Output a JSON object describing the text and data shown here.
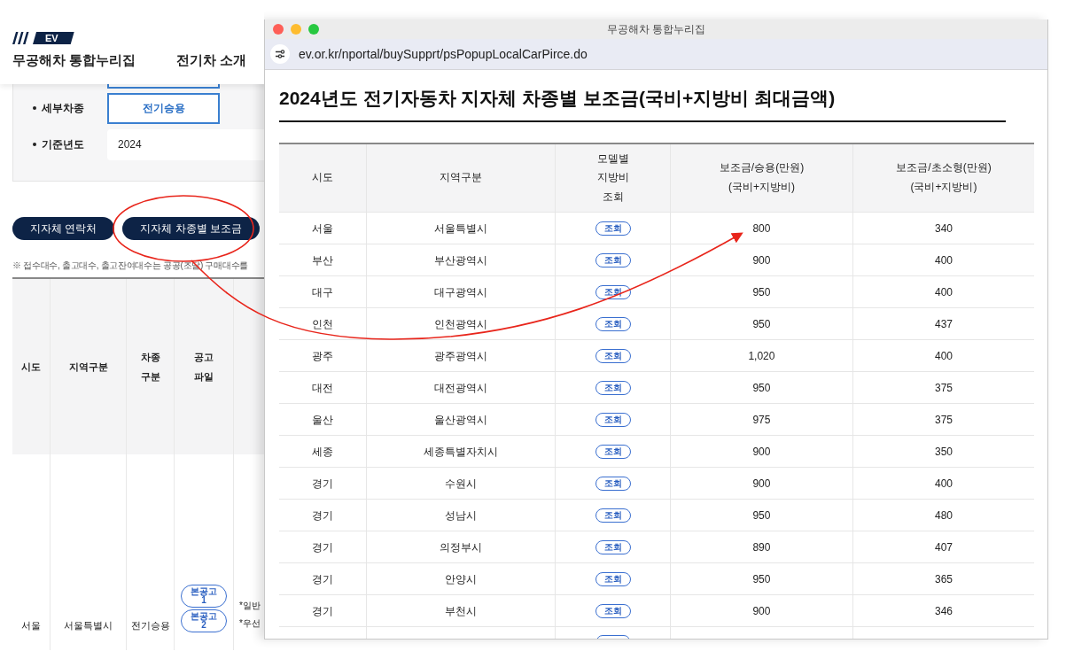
{
  "background_page": {
    "logo_badge": "EV",
    "site_name": "무공해차 통합누리집",
    "nav_item": "전기차 소개",
    "form": [
      {
        "label": "세부차종",
        "kind": "button",
        "value": "전기승용"
      },
      {
        "label": "기준년도",
        "kind": "input",
        "value": "2024"
      }
    ],
    "buttons": [
      "지자체 연락처",
      "지자체 차종별 보조금"
    ],
    "note": "※ 접수대수, 출고대수, 출고잔여대수는 공공(조달) 구매대수를",
    "table": {
      "columns": [
        "시도",
        "지역구분",
        "차종\n구분",
        "공고\n파일"
      ],
      "rows": [
        {
          "cells": [
            "서울",
            "서울특별시",
            "전기승용"
          ],
          "files": [
            "본공고\n1",
            "본공고\n2"
          ],
          "notes": [
            "*일반",
            "*우선"
          ]
        }
      ]
    }
  },
  "popup": {
    "title": "무공해차 통합누리집",
    "url": "ev.or.kr/nportal/buySupprt/psPopupLocalCarPirce.do",
    "heading": "2024년도 전기자동차 지자체 차종별 보조금(국비+지방비 최대금액)",
    "table": {
      "columns": [
        "시도",
        "지역구분",
        "모델별\n지방비\n조회",
        "보조금/승용(만원)\n(국비+지방비)",
        "보조금/초소형(만원)\n(국비+지방비)"
      ],
      "rows": [
        {
          "sido": "서울",
          "region": "서울특별시",
          "lookup": "조회",
          "sedan": "800",
          "compact": "340"
        },
        {
          "sido": "부산",
          "region": "부산광역시",
          "lookup": "조회",
          "sedan": "900",
          "compact": "400"
        },
        {
          "sido": "대구",
          "region": "대구광역시",
          "lookup": "조회",
          "sedan": "950",
          "compact": "400"
        },
        {
          "sido": "인천",
          "region": "인천광역시",
          "lookup": "조회",
          "sedan": "950",
          "compact": "437"
        },
        {
          "sido": "광주",
          "region": "광주광역시",
          "lookup": "조회",
          "sedan": "1,020",
          "compact": "400"
        },
        {
          "sido": "대전",
          "region": "대전광역시",
          "lookup": "조회",
          "sedan": "950",
          "compact": "375"
        },
        {
          "sido": "울산",
          "region": "울산광역시",
          "lookup": "조회",
          "sedan": "975",
          "compact": "375"
        },
        {
          "sido": "세종",
          "region": "세종특별자치시",
          "lookup": "조회",
          "sedan": "900",
          "compact": "350"
        },
        {
          "sido": "경기",
          "region": "수원시",
          "lookup": "조회",
          "sedan": "900",
          "compact": "400"
        },
        {
          "sido": "경기",
          "region": "성남시",
          "lookup": "조회",
          "sedan": "950",
          "compact": "480"
        },
        {
          "sido": "경기",
          "region": "의정부시",
          "lookup": "조회",
          "sedan": "890",
          "compact": "407"
        },
        {
          "sido": "경기",
          "region": "안양시",
          "lookup": "조회",
          "sedan": "950",
          "compact": "365"
        },
        {
          "sido": "경기",
          "region": "부천시",
          "lookup": "조회",
          "sedan": "900",
          "compact": "346"
        }
      ]
    }
  }
}
